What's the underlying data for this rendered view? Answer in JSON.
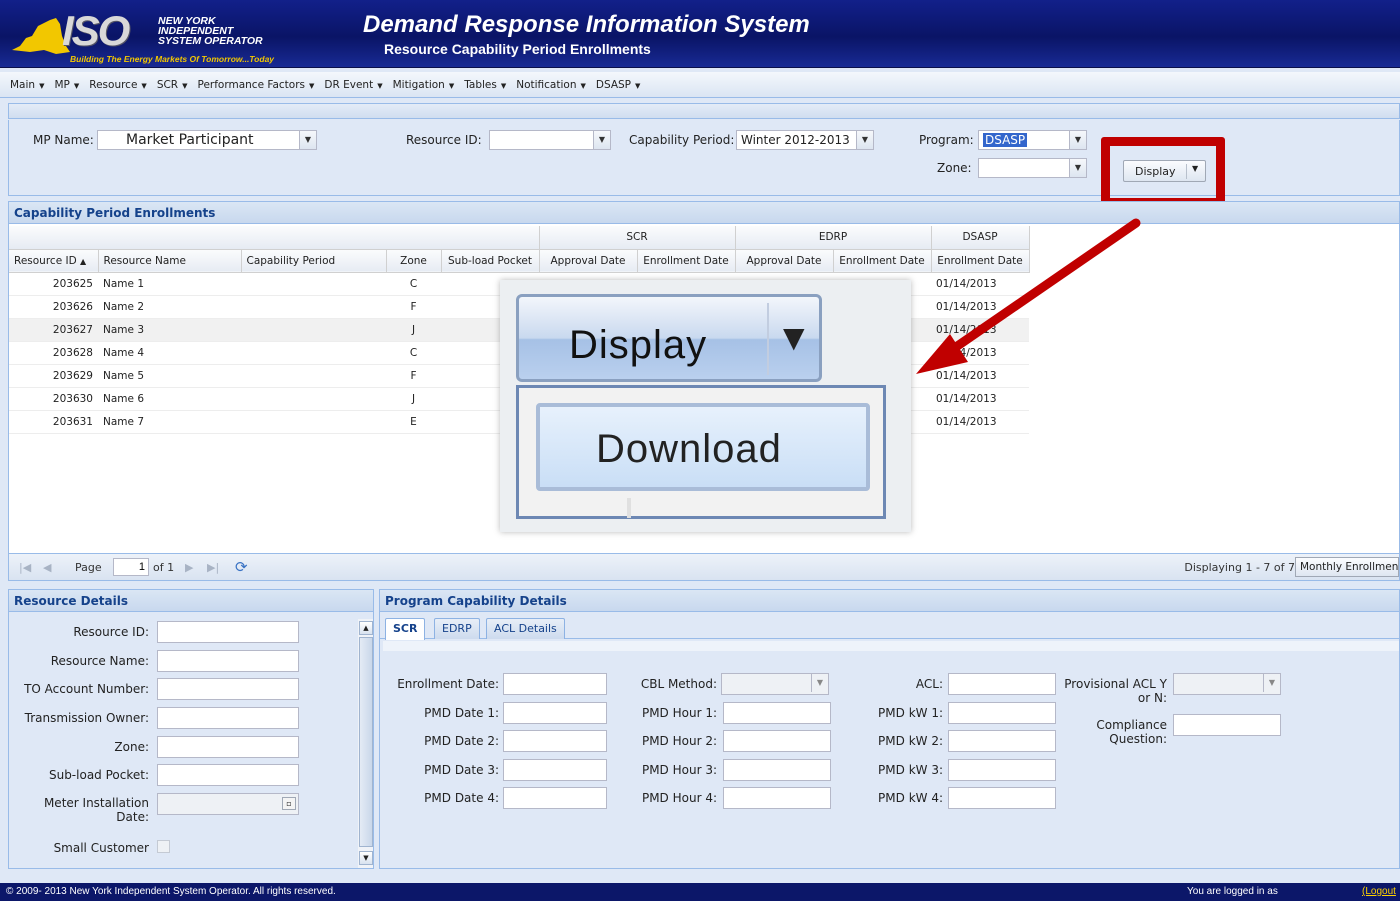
{
  "header": {
    "logo_text": "ISO",
    "logo_name_lines": [
      "NEW YORK",
      "INDEPENDENT",
      "SYSTEM OPERATOR"
    ],
    "logo_tagline": "Building The Energy Markets Of Tomorrow...Today",
    "title": "Demand Response Information System",
    "subtitle": "Resource Capability Period Enrollments"
  },
  "menu": [
    "Main",
    "MP",
    "Resource",
    "SCR",
    "Performance Factors",
    "DR Event",
    "Mitigation",
    "Tables",
    "Notification",
    "DSASP"
  ],
  "filters": {
    "mp_name_label": "MP Name:",
    "mp_name_value": "Market Participant",
    "resource_id_label": "Resource ID:",
    "resource_id_value": "",
    "capability_period_label": "Capability Period:",
    "capability_period_value": "Winter 2012-2013",
    "program_label": "Program:",
    "program_value": "DSASP",
    "zone_label": "Zone:",
    "zone_value": "",
    "display_button": "Display"
  },
  "grid": {
    "title": "Capability Period Enrollments",
    "group_headers": [
      "SCR",
      "EDRP",
      "DSASP"
    ],
    "columns": [
      "Resource ID",
      "Resource Name",
      "Capability Period",
      "Zone",
      "Sub-load Pocket",
      "Approval Date",
      "Enrollment Date",
      "Approval Date",
      "Enrollment Date",
      "Enrollment Date"
    ],
    "rows": [
      [
        "203625",
        "Name 1",
        "",
        "C",
        "",
        "",
        "",
        "",
        "",
        "01/14/2013"
      ],
      [
        "203626",
        "Name 2",
        "",
        "F",
        "",
        "",
        "",
        "",
        "",
        "01/14/2013"
      ],
      [
        "203627",
        "Name 3",
        "",
        "J",
        "",
        "",
        "",
        "",
        "",
        "01/14/2013"
      ],
      [
        "203628",
        "Name 4",
        "",
        "C",
        "",
        "",
        "",
        "",
        "",
        "01/14/2013"
      ],
      [
        "203629",
        "Name 5",
        "",
        "F",
        "",
        "",
        "",
        "",
        "",
        "01/14/2013"
      ],
      [
        "203630",
        "Name 6",
        "",
        "J",
        "",
        "",
        "",
        "",
        "",
        "01/14/2013"
      ],
      [
        "203631",
        "Name 7",
        "",
        "E",
        "",
        "",
        "",
        "",
        "",
        "01/14/2013"
      ]
    ]
  },
  "pager": {
    "page_label": "Page",
    "page_value": "1",
    "of_label": "of 1",
    "status": "Displaying 1 - 7 of 7",
    "monthly_button": "Monthly Enrollment"
  },
  "resource_details": {
    "title": "Resource Details",
    "labels": [
      "Resource ID:",
      "Resource Name:",
      "TO Account Number:",
      "Transmission Owner:",
      "Zone:",
      "Sub-load Pocket:",
      "Meter Installation Date:",
      "Small Customer"
    ]
  },
  "program_details": {
    "title": "Program Capability Details",
    "tabs": [
      "SCR",
      "EDRP",
      "ACL Details"
    ],
    "col1": [
      "Enrollment Date:",
      "PMD Date 1:",
      "PMD Date 2:",
      "PMD Date 3:",
      "PMD Date 4:"
    ],
    "col2": [
      "CBL Method:",
      "PMD Hour 1:",
      "PMD Hour 2:",
      "PMD Hour 3:",
      "PMD Hour 4:"
    ],
    "col3": [
      "ACL:",
      "PMD kW 1:",
      "PMD kW 2:",
      "PMD kW 3:",
      "PMD kW 4:"
    ],
    "provisional_acl_label": "Provisional ACL Y or N:",
    "compliance_label": "Compliance Question:"
  },
  "callout": {
    "display_label": "Display",
    "download_label": "Download"
  },
  "footer": {
    "copyright": "© 2009- 2013 New York Independent System Operator. All rights reserved.",
    "logged_in": "You are logged in as",
    "logout": "(Logout"
  },
  "colors": {
    "header_bg": "#0a1466",
    "highlight": "#c00000",
    "panel_title": "#15428b",
    "panel_bg": "#dfe8f6"
  }
}
